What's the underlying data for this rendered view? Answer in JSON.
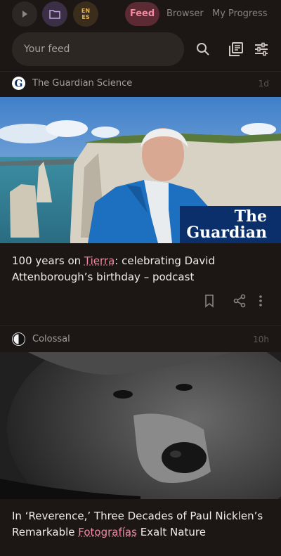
{
  "top": {
    "lang_top": "EN",
    "lang_bottom": "ES",
    "tabs": [
      "Feed",
      "Browser",
      "My Progress"
    ]
  },
  "search": {
    "placeholder": "Your feed"
  },
  "articles": [
    {
      "source": "The Guardian Science",
      "time": "1d",
      "title_before": "100 years on ",
      "title_highlight": "Tierra",
      "title_after": ": celebrating David Attenborough’s birthday – podcast",
      "badge_line1": "The",
      "badge_line2": "Guardian"
    },
    {
      "source": "Colossal",
      "time": "10h",
      "title_before": "In ‘Reverence,’ Three Decades of Paul Nicklen’s Remarkable ",
      "title_highlight": "Fotografías",
      "title_after": " Exalt Nature"
    }
  ],
  "colors": {
    "background": "#1c1715",
    "accent_pink": "#f08aa0",
    "feed_tab_bg": "#5c2a33",
    "guardian_blue": "#0b2f6b"
  },
  "icons": [
    "play-icon",
    "folder-icon",
    "language-icon",
    "search-icon",
    "library-icon",
    "filter-icon",
    "bookmark-icon",
    "share-icon",
    "more-vert-icon"
  ]
}
